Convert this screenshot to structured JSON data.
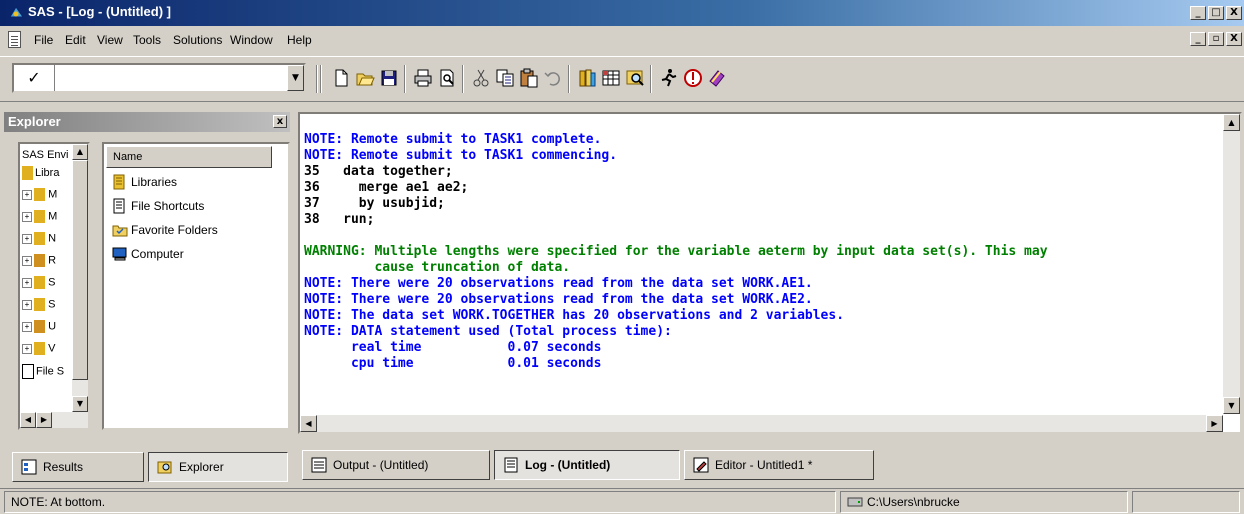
{
  "window": {
    "title": "SAS - [Log - (Untitled) ]",
    "controls_outer": [
      "_",
      "□",
      "X"
    ],
    "controls_inner": [
      "_",
      "▫",
      "X"
    ]
  },
  "menu": {
    "items": [
      "File",
      "Edit",
      "View",
      "Tools",
      "Solutions",
      "Window",
      "Help"
    ]
  },
  "toolbar": {
    "command_value": "",
    "check_glyph": "✓",
    "dropdown_glyph": "▼",
    "icons": [
      "new-icon",
      "open-icon",
      "save-icon",
      "print-icon",
      "print-preview-icon",
      "cut-icon",
      "copy-icon",
      "paste-icon",
      "undo-icon",
      "libraries-icon",
      "sas-dataset-icon",
      "explorer-icon",
      "submit-icon",
      "break-icon",
      "help-icon"
    ]
  },
  "explorer": {
    "title": "Explorer",
    "close_glyph": "x",
    "tree": {
      "header": "SAS Envi",
      "rows": [
        "Libra",
        "M",
        "M",
        "N",
        "R",
        "S",
        "S",
        "U",
        "V",
        "File S"
      ]
    },
    "list": {
      "header": "Name",
      "items": [
        {
          "label": "Libraries",
          "icon": "libraries-icon"
        },
        {
          "label": "File Shortcuts",
          "icon": "file-shortcuts-icon"
        },
        {
          "label": "Favorite Folders",
          "icon": "favorite-folders-icon"
        },
        {
          "label": "Computer",
          "icon": "computer-icon"
        }
      ]
    }
  },
  "left_tabs": {
    "results": "Results",
    "explorer": "Explorer"
  },
  "log": {
    "lines": [
      {
        "type": "note",
        "text": "NOTE: Remote submit to TASK1 complete."
      },
      {
        "type": "note",
        "text": "NOTE: Remote submit to TASK1 commencing."
      },
      {
        "type": "src",
        "text": "35   data together;"
      },
      {
        "type": "src",
        "text": "36     merge ae1 ae2;"
      },
      {
        "type": "src",
        "text": "37     by usubjid;"
      },
      {
        "type": "src",
        "text": "38   run;"
      },
      {
        "type": "blank",
        "text": ""
      },
      {
        "type": "warn",
        "text": "WARNING: Multiple lengths were specified for the variable aeterm by input data set(s). This may"
      },
      {
        "type": "warn",
        "text": "         cause truncation of data."
      },
      {
        "type": "note",
        "text": "NOTE: There were 20 observations read from the data set WORK.AE1."
      },
      {
        "type": "note",
        "text": "NOTE: There were 20 observations read from the data set WORK.AE2."
      },
      {
        "type": "note",
        "text": "NOTE: The data set WORK.TOGETHER has 20 observations and 2 variables."
      },
      {
        "type": "note",
        "text": "NOTE: DATA statement used (Total process time):"
      },
      {
        "type": "note",
        "text": "      real time           0.07 seconds"
      },
      {
        "type": "note",
        "text": "      cpu time            0.01 seconds"
      }
    ]
  },
  "window_tabs": [
    {
      "label": "Output - (Untitled)",
      "icon": "output-icon",
      "selected": false
    },
    {
      "label": "Log - (Untitled)",
      "icon": "log-icon",
      "selected": true
    },
    {
      "label": "Editor - Untitled1 *",
      "icon": "editor-icon",
      "selected": false
    }
  ],
  "status": {
    "message": "NOTE: At bottom.",
    "path": "C:\\Users\\nbrucke"
  }
}
